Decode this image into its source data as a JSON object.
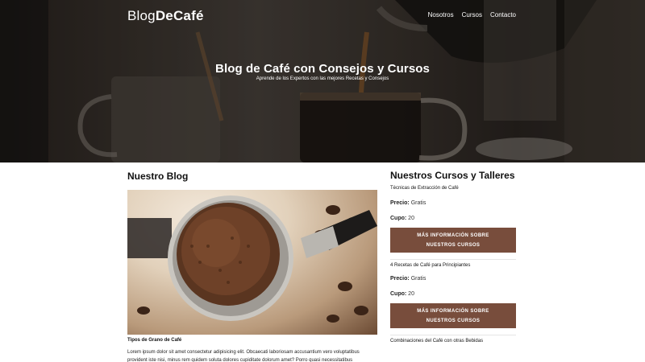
{
  "header": {
    "logo_light": "Blog",
    "logo_bold": "DeCafé",
    "nav": [
      "Nosotros",
      "Cursos",
      "Contacto"
    ],
    "title": "Blog de Café con Consejos y Cursos",
    "subtitle": "Aprende de los Expertos con las mejores Recetas y Consejos"
  },
  "blog": {
    "heading": "Nuestro Blog",
    "post": {
      "title": "Tipos de Grano de Café",
      "excerpt": "Lorem ipsum dolor sit amet consectetur adipisicing elit. Obcaecati laboriosam accusantium vero voluptatibus provident iste nisi, minus rem quidem soluta dolores cupiditate dolorum amet? Porro quasi necessitatibus"
    }
  },
  "courses": {
    "heading": "Nuestros Cursos y Talleres",
    "price_label": "Precio:",
    "capacity_label": "Cupo:",
    "items": [
      {
        "name": "Técnicas de Extracción de Café",
        "price": "Gratis",
        "capacity": "20",
        "button": "MÁS INFORMACIÓN SOBRE NUESTROS CURSOS"
      },
      {
        "name": "4 Recetas de Café para Principiantes",
        "price": "Gratis",
        "capacity": "20",
        "button": "MÁS INFORMACIÓN SOBRE NUESTROS CURSOS"
      },
      {
        "name": "Combinaciones del Café con otras Bebidas"
      }
    ]
  },
  "colors": {
    "button": "#784d3c",
    "hero_overlay": "#2a2420"
  }
}
